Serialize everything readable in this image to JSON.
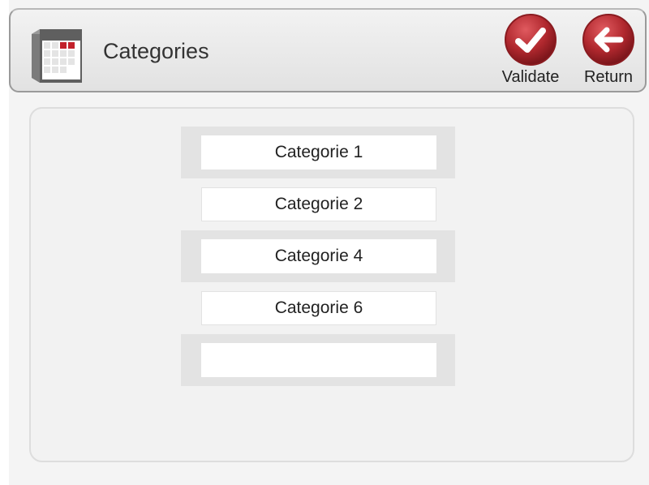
{
  "header": {
    "title": "Categories",
    "icon": "calendar-icon"
  },
  "actions": {
    "validate": {
      "label": "Validate",
      "icon": "checkmark-icon",
      "color": "#b0282e"
    },
    "return": {
      "label": "Return",
      "icon": "arrow-left-icon",
      "color": "#b0282e"
    }
  },
  "categories": [
    {
      "label": "Categorie 1"
    },
    {
      "label": "Categorie 2"
    },
    {
      "label": "Categorie 4"
    },
    {
      "label": "Categorie 6"
    },
    {
      "label": ""
    }
  ],
  "colors": {
    "accent_red": "#b0282e",
    "row_shade": "#e3e3e3",
    "background": "#f4f4f4"
  }
}
